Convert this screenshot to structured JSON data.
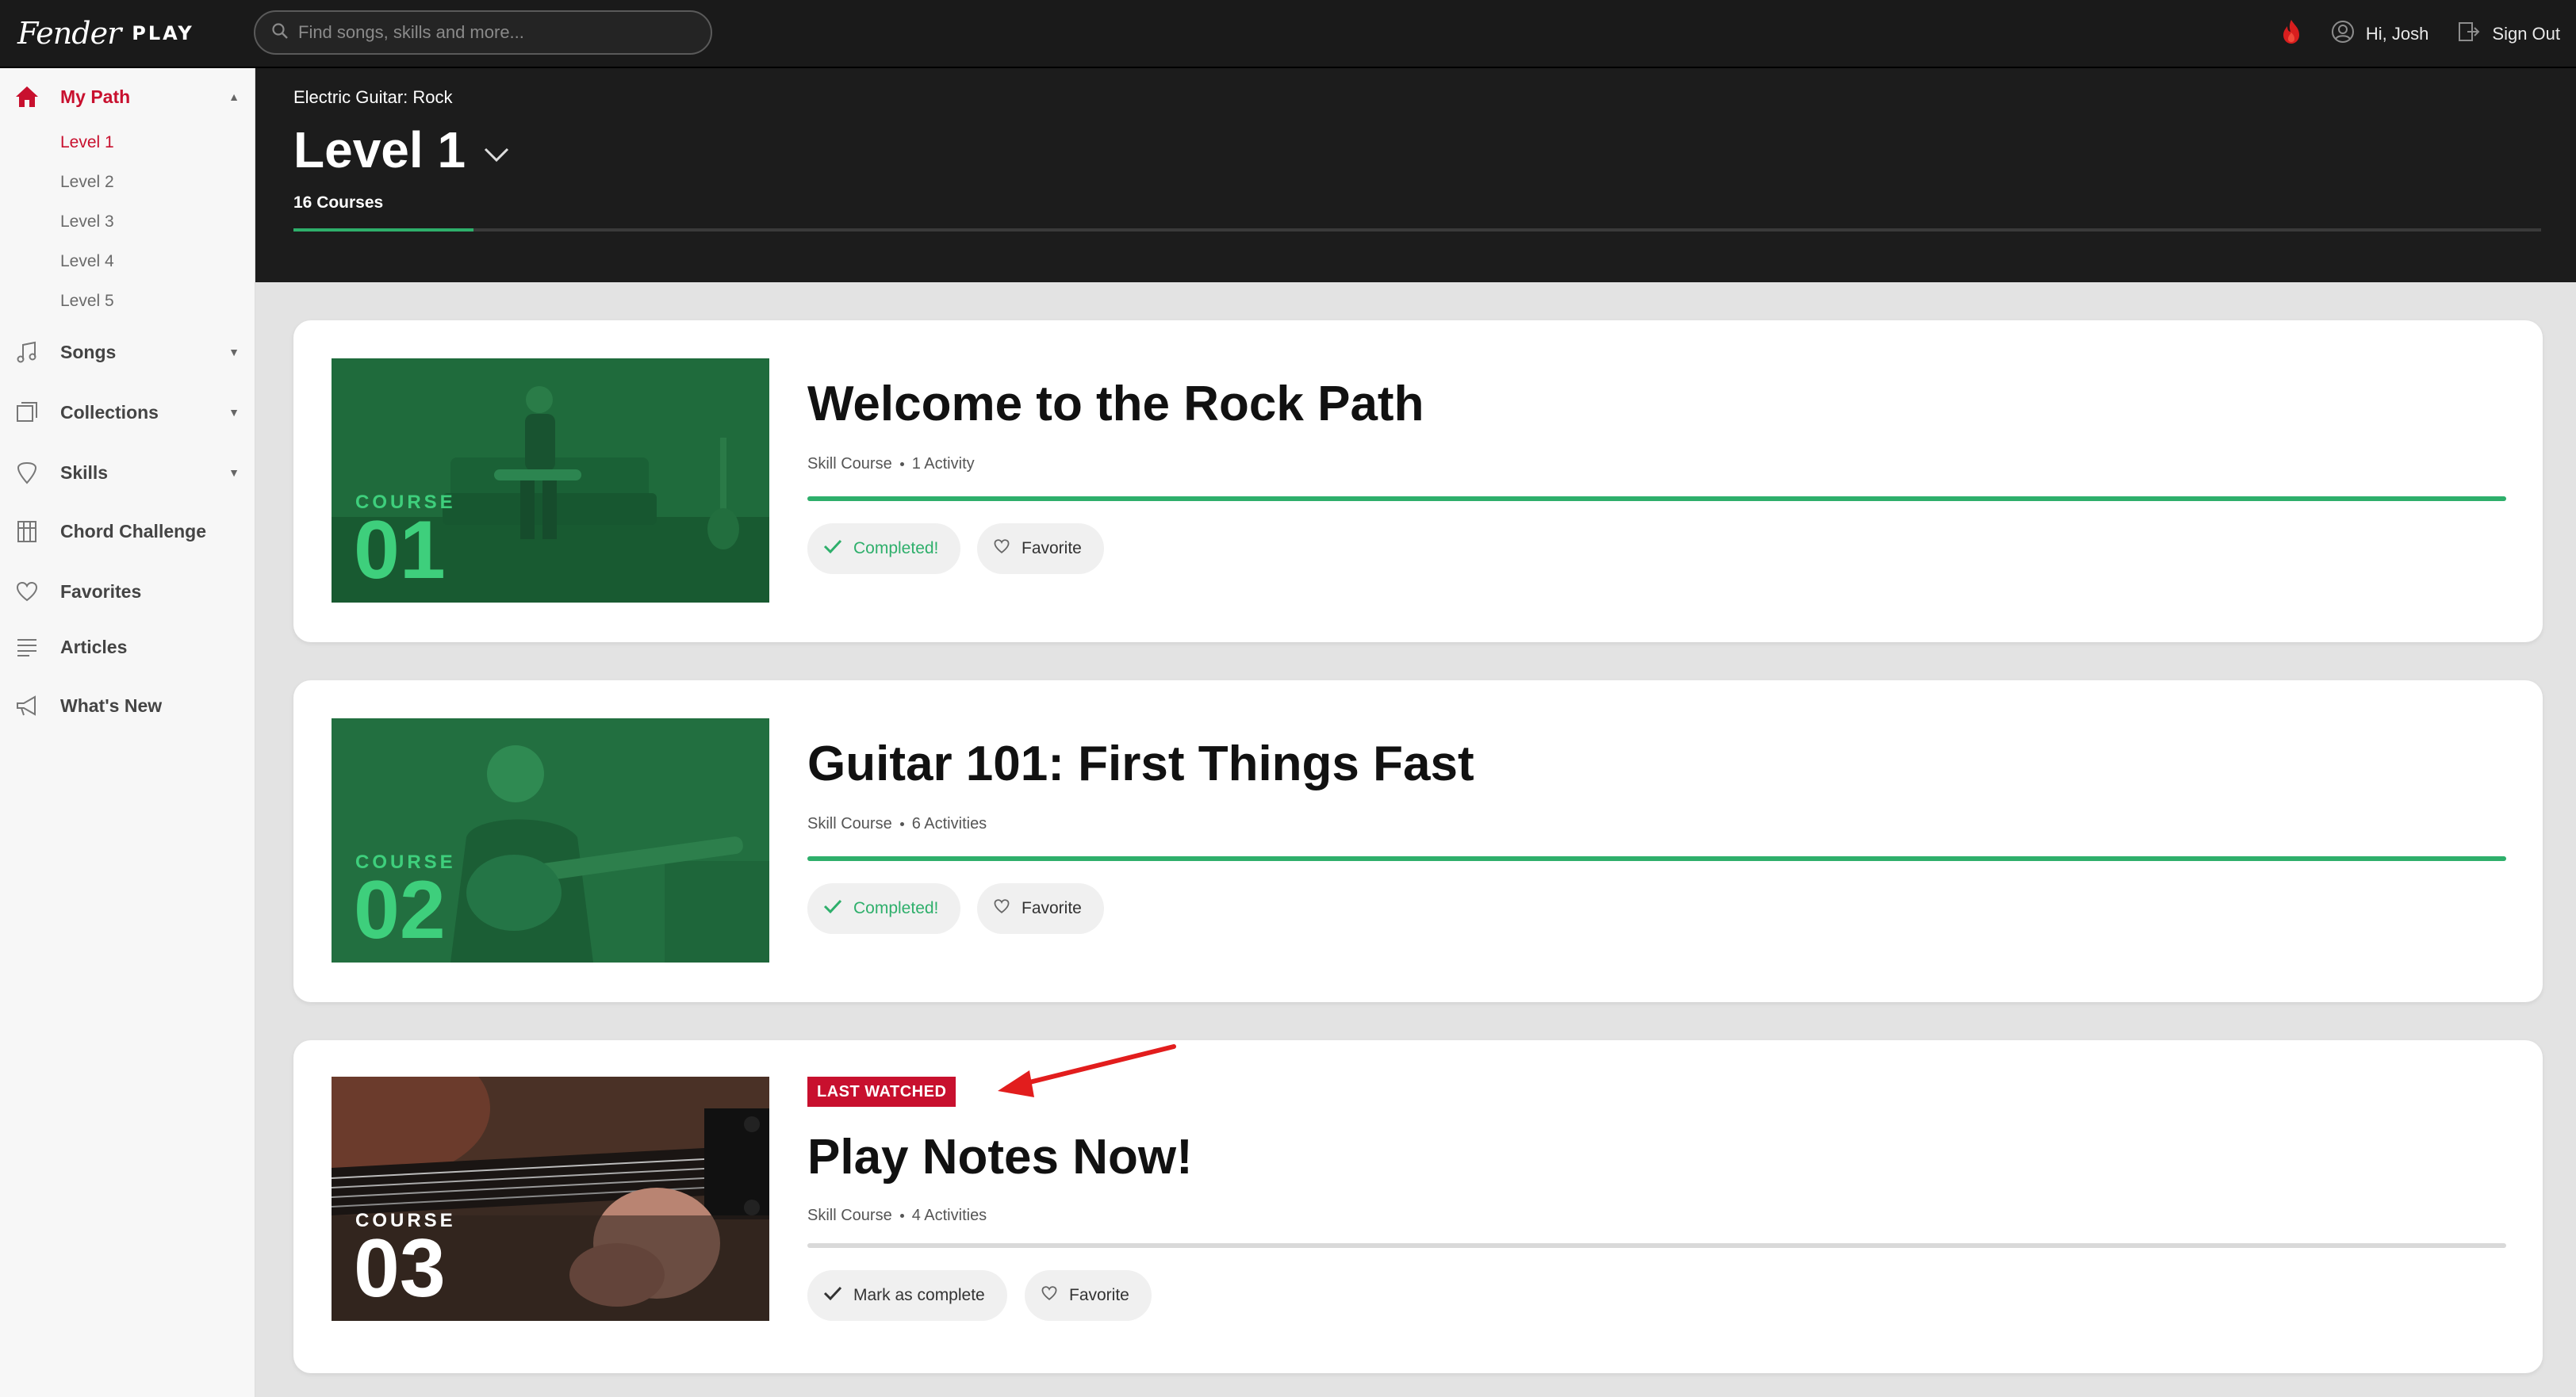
{
  "topbar": {
    "logo_script": "Fender",
    "logo_play": "PLAY",
    "search_placeholder": "Find songs, skills and more...",
    "greeting": "Hi, Josh",
    "sign_out": "Sign Out",
    "streak_icon": "flame-icon",
    "user_icon": "user-icon",
    "signout_icon": "signout-icon"
  },
  "sidebar": {
    "my_path": "My Path",
    "levels": [
      "Level 1",
      "Level 2",
      "Level 3",
      "Level 4",
      "Level 5"
    ],
    "items": [
      {
        "label": "Songs",
        "icon": "music-icon"
      },
      {
        "label": "Collections",
        "icon": "collections-icon"
      },
      {
        "label": "Skills",
        "icon": "pick-icon"
      },
      {
        "label": "Chord Challenge",
        "icon": "chord-grid-icon"
      },
      {
        "label": "Favorites",
        "icon": "heart-icon"
      },
      {
        "label": "Articles",
        "icon": "article-icon"
      },
      {
        "label": "What's New",
        "icon": "megaphone-icon"
      }
    ]
  },
  "header": {
    "breadcrumb": "Electric Guitar: Rock",
    "title": "Level 1",
    "course_count": "16 Courses",
    "progress_fraction": 0.08
  },
  "courses": [
    {
      "course_label": "COURSE",
      "number": "01",
      "title": "Welcome to the Rock Path",
      "type": "Skill Course",
      "activities": "1 Activity",
      "status": "Completed!",
      "favorite": "Favorite",
      "progress_fraction": 1.0,
      "badge": ""
    },
    {
      "course_label": "COURSE",
      "number": "02",
      "title": "Guitar 101: First Things Fast",
      "type": "Skill Course",
      "activities": "6 Activities",
      "status": "Completed!",
      "favorite": "Favorite",
      "progress_fraction": 1.0,
      "badge": ""
    },
    {
      "course_label": "COURSE",
      "number": "03",
      "title": "Play Notes Now!",
      "type": "Skill Course",
      "activities": "4 Activities",
      "status": "Mark as complete",
      "favorite": "Favorite",
      "progress_fraction": 0.0,
      "badge": "LAST WATCHED"
    }
  ],
  "colors": {
    "accent_red": "#c8102e",
    "progress_green": "#2eaf6b",
    "topbar": "#1a1a1a"
  }
}
